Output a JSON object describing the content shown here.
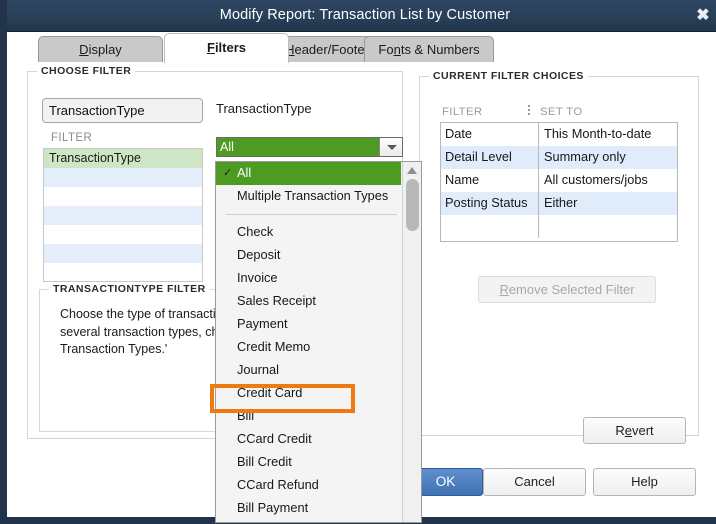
{
  "window": {
    "title": "Modify Report: Transaction List by Customer",
    "close_icon": "close-icon",
    "title_bar_color": "#2b4158",
    "accent_green": "#4d9b23",
    "accent_blue": "#4073b4",
    "annotation_color": "#f07a12"
  },
  "tabs": [
    {
      "label": "Display",
      "mnemonic": "D",
      "active": false
    },
    {
      "label": "Filters",
      "mnemonic": "F",
      "active": true
    },
    {
      "label": "Header/Footer",
      "mnemonic": "H",
      "active": false
    },
    {
      "label": "Fonts & Numbers",
      "mnemonic": "n",
      "active": false
    }
  ],
  "choose_filter": {
    "group_title": "CHOOSE FILTER",
    "search_value": "TransactionType",
    "search_placeholder": "",
    "list_label": "FILTER",
    "list_items": [
      "TransactionType",
      "",
      "",
      "",
      "",
      "",
      ""
    ],
    "selected_index": 0
  },
  "description": {
    "group_title": "TRANSACTIONTYPE FILTER",
    "text": "Choose the type of transaction. To select several transaction types, choose 'Multiple Transaction Types.'"
  },
  "combo": {
    "caption": "TransactionType",
    "value": "All",
    "arrow_icon": "chevron-down-icon"
  },
  "dropdown": {
    "check_icon": "check-icon",
    "scroll_up_icon": "chevron-up-icon",
    "items": [
      {
        "label": "All",
        "checked": true,
        "separator_after": false
      },
      {
        "label": "Multiple Transaction Types",
        "checked": false,
        "separator_after": true
      },
      {
        "label": "Check",
        "checked": false,
        "separator_after": false
      },
      {
        "label": "Deposit",
        "checked": false,
        "separator_after": false
      },
      {
        "label": "Invoice",
        "checked": false,
        "separator_after": false
      },
      {
        "label": "Sales Receipt",
        "checked": false,
        "separator_after": false
      },
      {
        "label": "Payment",
        "checked": false,
        "separator_after": false,
        "highlighted": true
      },
      {
        "label": "Credit Memo",
        "checked": false,
        "separator_after": false
      },
      {
        "label": "Journal",
        "checked": false,
        "separator_after": false
      },
      {
        "label": "Credit Card",
        "checked": false,
        "separator_after": false
      },
      {
        "label": "Bill",
        "checked": false,
        "separator_after": false
      },
      {
        "label": "CCard Credit",
        "checked": false,
        "separator_after": false
      },
      {
        "label": "Bill Credit",
        "checked": false,
        "separator_after": false
      },
      {
        "label": "CCard Refund",
        "checked": false,
        "separator_after": false
      },
      {
        "label": "Bill Payment",
        "checked": false,
        "separator_after": false
      }
    ]
  },
  "current_filter_choices": {
    "group_title": "CURRENT FILTER CHOICES",
    "col_filter": "FILTER",
    "col_setto": "SET TO",
    "rows": [
      {
        "filter": "Date",
        "set_to": "This Month-to-date"
      },
      {
        "filter": "Detail Level",
        "set_to": "Summary only"
      },
      {
        "filter": "Name",
        "set_to": "All customers/jobs"
      },
      {
        "filter": "Posting Status",
        "set_to": "Either"
      },
      {
        "filter": "",
        "set_to": ""
      }
    ],
    "remove_button": "Remove Selected Filter",
    "remove_button_mnemonic": "R",
    "revert_button": "Revert",
    "revert_button_mnemonic": "e"
  },
  "footer": {
    "ok": "OK",
    "cancel": "Cancel",
    "help": "Help"
  }
}
